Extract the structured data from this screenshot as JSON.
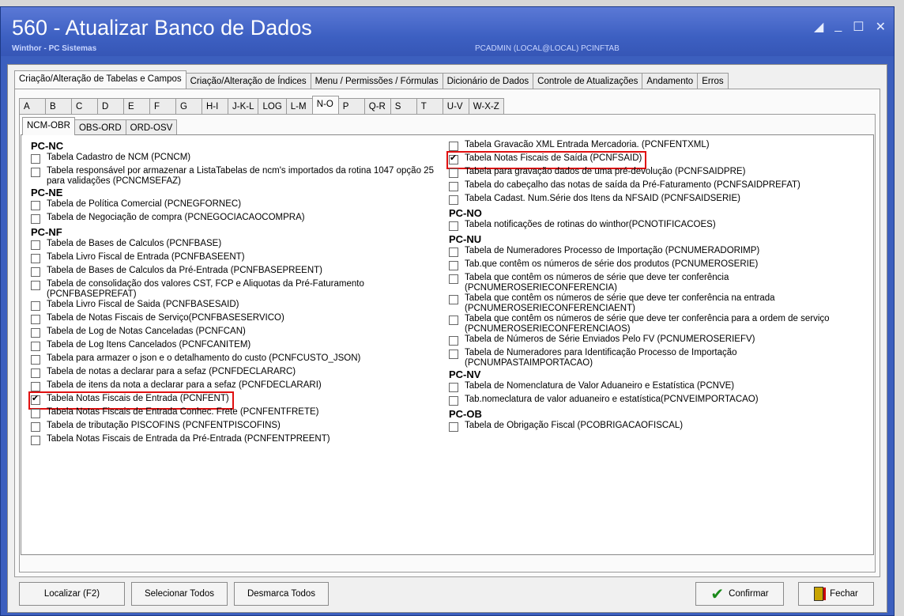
{
  "window": {
    "title": "560 - Atualizar Banco de Dados",
    "subtitle": "Winthor - PC Sistemas",
    "user_info": "PCADMIN (LOCAL@LOCAL)   PCINFTAB"
  },
  "main_tabs": [
    {
      "label": "Criação/Alteração de Tabelas e Campos"
    },
    {
      "label": "Criação/Alteração de Índices"
    },
    {
      "label": "Menu / Permissões / Fórmulas"
    },
    {
      "label": "Dicionário de Dados"
    },
    {
      "label": "Controle de Atualizações"
    },
    {
      "label": "Andamento"
    },
    {
      "label": "Erros"
    }
  ],
  "letter_tabs": [
    "A",
    "B",
    "C",
    "D",
    "E",
    "F",
    "G",
    "H-I",
    "J-K-L",
    "LOG",
    "L-M",
    "N-O",
    "P",
    "Q-R",
    "S",
    "T",
    "U-V",
    "W-X-Z"
  ],
  "sub_tabs": [
    "NCM-OBR",
    "OBS-ORD",
    "ORD-OSV"
  ],
  "left_column": {
    "g1": "PC-NC",
    "g1_items": [
      "Tabela Cadastro de NCM (PCNCM)",
      "Tabela responsável por armazenar a ListaTabelas de ncm's importados da rotina 1047 opção 25 para validações (PCNCMSEFAZ)"
    ],
    "g2": "PC-NE",
    "g2_items": [
      "Tabela de Política Comercial (PCNEGFORNEC)",
      "Tabela de Negociação de compra (PCNEGOCIACAOCOMPRA)"
    ],
    "g3": "PC-NF",
    "g3_items": [
      "Tabela de Bases de Calculos (PCNFBASE)",
      "Tabela Livro Fiscal de Entrada (PCNFBASEENT)",
      "Tabela de Bases de Calculos da Pré-Entrada (PCNFBASEPREENT)",
      "Tabela de consolidação dos valores CST, FCP e Aliquotas da Pré-Faturamento (PCNFBASEPREFAT)",
      "Tabela Livro Fiscal de Saida (PCNFBASESAID)",
      "Tabela de Notas Fiscais de Serviço(PCNFBASESERVICO)",
      "Tabela de Log de Notas Canceladas (PCNFCAN)",
      "Tabela de Log Itens Cancelados (PCNFCANITEM)",
      "Tabela para armazer o json e o detalhamento do custo (PCNFCUSTO_JSON)",
      "Tabela de notas a declarar para a sefaz (PCNFDECLARARC)",
      "Tabela de itens da nota a declarar para a sefaz (PCNFDECLARARI)",
      "Tabela Notas Fiscais de Entrada (PCNFENT)",
      "Tabela Notas Fiscais de Entrada  Conhec. Frete (PCNFENTFRETE)",
      "Tabela de tributação PISCOFINS (PCNFENTPISCOFINS)",
      "Tabela Notas Fiscais de Entrada da Pré-Entrada (PCNFENTPREENT)"
    ]
  },
  "right_column": {
    "top_items": [
      "Tabela Gravacão XML Entrada Mercadoria. (PCNFENTXML)",
      "Tabela Notas Fiscais de Saída (PCNFSAID)",
      "Tabela para gravação dados de uma pré-devolução (PCNFSAIDPRE)",
      "Tabela do cabeçalho das notas de saída da Pré-Faturamento (PCNFSAIDPREFAT)",
      "Tabela Cadast. Num.Série dos Itens da NFSAID (PCNFSAIDSERIE)"
    ],
    "g1": "PC-NO",
    "g1_items": [
      "Tabela notificações de rotinas do winthor(PCNOTIFICACOES)"
    ],
    "g2": "PC-NU",
    "g2_items": [
      "Tabela de Numeradores Processo de Importação (PCNUMERADORIMP)",
      "Tab.que contêm os números de série dos produtos (PCNUMEROSERIE)",
      "Tabela que contêm os números de série que deve ter conferência (PCNUMEROSERIECONFERENCIA)",
      "Tabela que contêm os números de série que deve ter conferência na entrada (PCNUMEROSERIECONFERENCIAENT)",
      "Tabela que contêm os números de série que deve ter conferência para a ordem de serviço (PCNUMEROSERIECONFERENCIAOS)",
      "Tabela de Números de Série Enviados Pelo FV (PCNUMEROSERIEFV)",
      "Tabela de Numeradores para Identificação Processo de Importação (PCNUMPASTAIMPORTACAO)"
    ],
    "g3": "PC-NV",
    "g3_items": [
      "Tabela de Nomenclatura de Valor Aduaneiro e Estatística (PCNVE)",
      "Tab.nomeclatura de valor aduaneiro e estatística(PCNVEIMPORTACAO)"
    ],
    "g4": "PC-OB",
    "g4_items": [
      "Tabela de Obrigação Fiscal  (PCOBRIGACAOFISCAL)"
    ]
  },
  "buttons": {
    "localizar": "Localizar (F2)",
    "selecionar": "Selecionar Todos",
    "desmarca": "Desmarca Todos",
    "confirmar": "Confirmar",
    "fechar": "Fechar"
  },
  "colors": {
    "title_bar": "#3d60c2",
    "highlight": "#e01010",
    "confirm_icon": "#1a8a1a"
  }
}
